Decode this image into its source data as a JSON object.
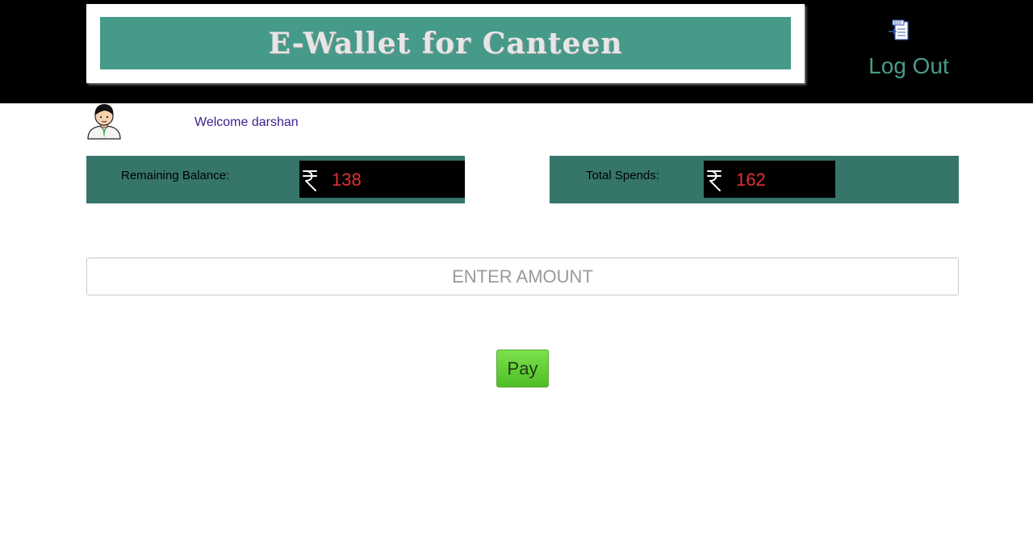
{
  "header": {
    "banner_title": "E-Wallet for Canteen",
    "logout_label": "Log Out",
    "logout_icon": "logout-icon"
  },
  "user": {
    "welcome_text": "Welcome darshan",
    "avatar_icon": "user-avatar-icon"
  },
  "balance": {
    "label": "Remaining Balance:",
    "currency_icon": "rupee-icon",
    "value": "138"
  },
  "spends": {
    "label": "Total Spends:",
    "currency_icon": "rupee-icon",
    "value": "162"
  },
  "payment": {
    "amount_placeholder": "ENTER AMOUNT",
    "amount_value": "",
    "pay_label": "Pay"
  },
  "colors": {
    "banner": "#459a8a",
    "card": "#35756a",
    "value_text": "#e53030",
    "logout_text": "#4a9a8b",
    "pay_button": "#5fcc30"
  }
}
